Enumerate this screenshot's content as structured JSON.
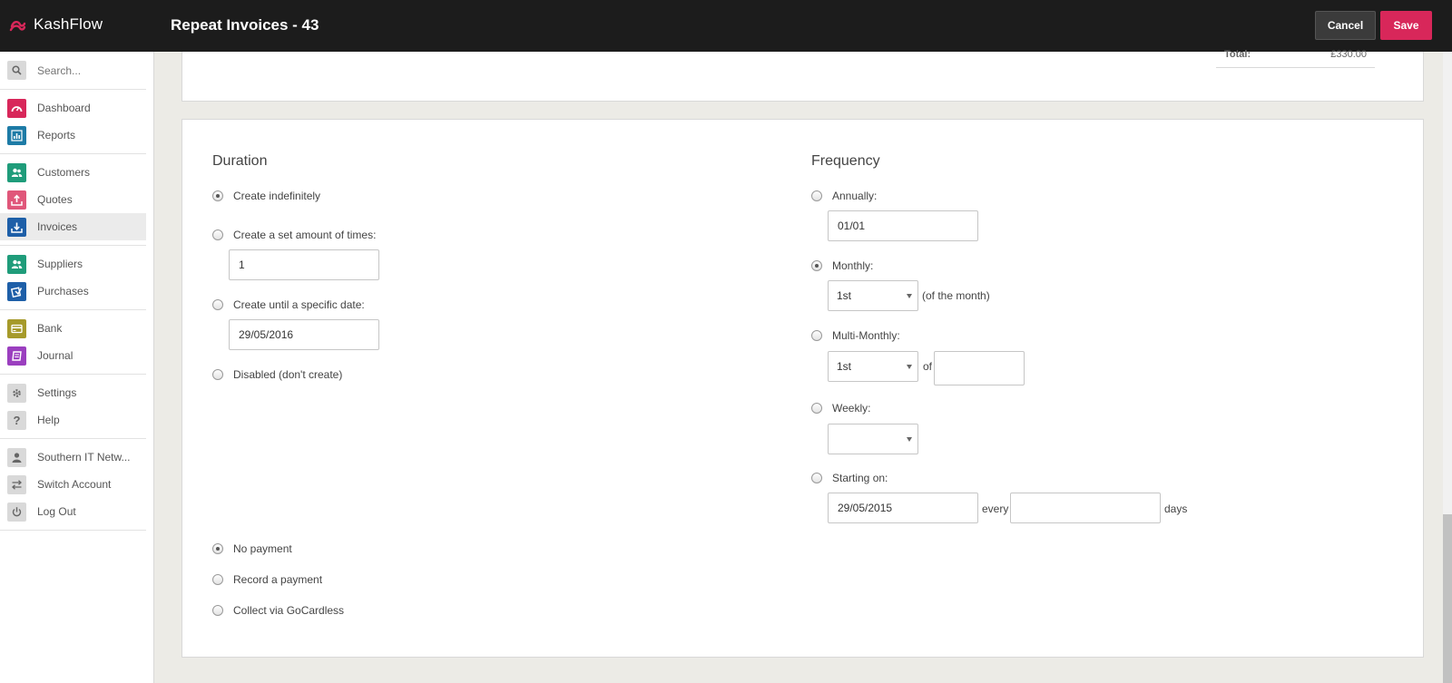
{
  "app": {
    "name": "KashFlow"
  },
  "header": {
    "title": "Repeat Invoices - 43",
    "cancel_label": "Cancel",
    "save_label": "Save"
  },
  "sidebar": {
    "search_placeholder": "Search...",
    "groups": [
      [
        {
          "label": "Dashboard",
          "icon": "speedometer-icon",
          "color": "#d8275a"
        },
        {
          "label": "Reports",
          "icon": "bar-chart-icon",
          "color": "#1d7ba6"
        }
      ],
      [
        {
          "label": "Customers",
          "icon": "people-icon",
          "color": "#1f9c7a"
        },
        {
          "label": "Quotes",
          "icon": "upload-tray-icon",
          "color": "#e0577a"
        },
        {
          "label": "Invoices",
          "icon": "download-tray-icon",
          "color": "#1e5fa8"
        }
      ],
      [
        {
          "label": "Suppliers",
          "icon": "people-icon",
          "color": "#1f9c7a"
        },
        {
          "label": "Purchases",
          "icon": "purchase-icon",
          "color": "#1e5fa8"
        }
      ],
      [
        {
          "label": "Bank",
          "icon": "bank-card-icon",
          "color": "#a69a2a"
        },
        {
          "label": "Journal",
          "icon": "book-icon",
          "color": "#9b3fbf"
        }
      ],
      [
        {
          "label": "Settings",
          "icon": "gear-icon",
          "color": "#d9d9d9"
        },
        {
          "label": "Help",
          "icon": "question-icon",
          "color": "#d9d9d9"
        }
      ],
      [
        {
          "label": "Southern IT Netw...",
          "icon": "user-icon",
          "color": "#d9d9d9"
        },
        {
          "label": "Switch Account",
          "icon": "swap-arrows-icon",
          "color": "#d9d9d9"
        },
        {
          "label": "Log Out",
          "icon": "power-icon",
          "color": "#d9d9d9"
        }
      ]
    ]
  },
  "summary": {
    "total_label": "Total:",
    "total_value": "£330.00"
  },
  "duration": {
    "title": "Duration",
    "indefinite": "Create indefinitely",
    "set_amount": "Create a set amount of times:",
    "set_amount_value": "1",
    "until_date": "Create until a specific date:",
    "until_date_value": "29/05/2016",
    "disabled": "Disabled (don't create)"
  },
  "payment": {
    "none": "No payment",
    "record": "Record a payment",
    "gocardless": "Collect via GoCardless"
  },
  "frequency": {
    "title": "Frequency",
    "annually": "Annually:",
    "annually_value": "01/01",
    "monthly": "Monthly:",
    "monthly_day": "1st",
    "monthly_suffix": "(of the month)",
    "multi_monthly": "Multi-Monthly:",
    "multi_monthly_day": "1st",
    "multi_monthly_of": "of",
    "multi_monthly_value": "",
    "weekly": "Weekly:",
    "weekly_value": "",
    "starting_on": "Starting on:",
    "starting_on_value": "29/05/2015",
    "every_label": "every",
    "every_value": "",
    "days_label": "days"
  }
}
